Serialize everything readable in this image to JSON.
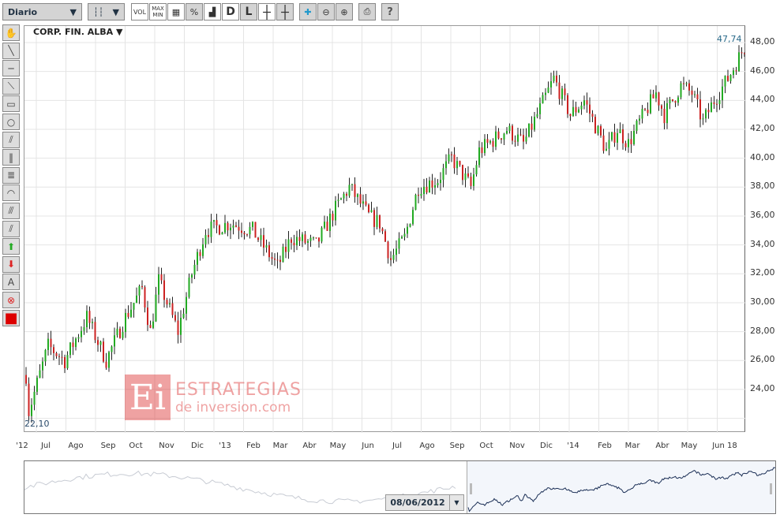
{
  "toolbar": {
    "period": "Diario",
    "vol": "VOL",
    "maxmin": "MAX MIN",
    "percent": "%",
    "d": "D",
    "l": "L",
    "help": "?"
  },
  "chart": {
    "title": "CORP. FIN. ALBA ▼",
    "last_label": "47,74",
    "min_label": "22,10",
    "y_ticks": [
      "48,00",
      "46,00",
      "44,00",
      "42,00",
      "40,00",
      "38,00",
      "36,00",
      "34,00",
      "32,00",
      "30,00",
      "28,00",
      "26,00",
      "24,00"
    ],
    "x_ticks": [
      "'12",
      "Jul",
      "Ago",
      "Sep",
      "Oct",
      "Nov",
      "Dic",
      "'13",
      "Feb",
      "Mar",
      "Abr",
      "May",
      "Jun",
      "Jul",
      "Ago",
      "Sep",
      "Oct",
      "Nov",
      "Dic",
      "'14",
      "Feb",
      "Mar",
      "Abr",
      "May",
      "Jun 18"
    ],
    "colors": {
      "up": "#22aa22",
      "down": "#cc2222",
      "line": "#1a2e55"
    }
  },
  "chart_data": {
    "type": "candlestick",
    "ylim": [
      21,
      49.5
    ],
    "price_path": [
      [
        0,
        25
      ],
      [
        1,
        22.5
      ],
      [
        8,
        27
      ],
      [
        14,
        26
      ],
      [
        22,
        29
      ],
      [
        29,
        26
      ],
      [
        36,
        29
      ],
      [
        42,
        31
      ],
      [
        45,
        28
      ],
      [
        48,
        31.5
      ],
      [
        55,
        28
      ],
      [
        60,
        32
      ],
      [
        65,
        35
      ],
      [
        74,
        35.5
      ],
      [
        82,
        35
      ],
      [
        91,
        32.5
      ],
      [
        96,
        34.5
      ],
      [
        105,
        34
      ],
      [
        112,
        36.5
      ],
      [
        117,
        38
      ],
      [
        124,
        36
      ],
      [
        128,
        35.5
      ],
      [
        132,
        33
      ],
      [
        137,
        34.5
      ],
      [
        142,
        38
      ],
      [
        149,
        38.5
      ],
      [
        154,
        40
      ],
      [
        161,
        38
      ],
      [
        164,
        40.5
      ],
      [
        174,
        42
      ],
      [
        180,
        41
      ],
      [
        185,
        43
      ],
      [
        191,
        45.5
      ],
      [
        197,
        43
      ],
      [
        202,
        44
      ],
      [
        210,
        40.5
      ],
      [
        214,
        42
      ],
      [
        218,
        41
      ],
      [
        222,
        42.5
      ],
      [
        228,
        44.5
      ],
      [
        231,
        43
      ],
      [
        237,
        45
      ],
      [
        241,
        44.5
      ],
      [
        245,
        42.5
      ],
      [
        249,
        44
      ],
      [
        254,
        45.5
      ],
      [
        260,
        47.7
      ]
    ]
  },
  "watermark": {
    "line1": "ESTRATEGIAS",
    "line2": "de inversion.com"
  },
  "navigator": {
    "date": "08/06/2012"
  }
}
